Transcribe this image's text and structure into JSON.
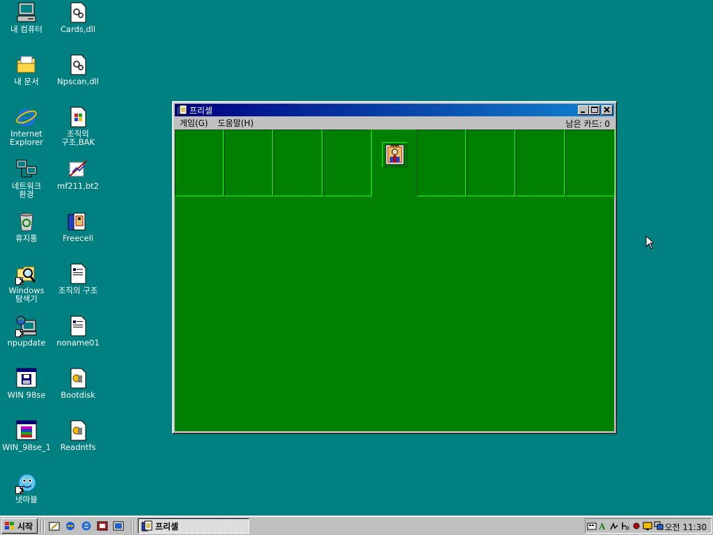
{
  "desktop": {
    "icons": [
      {
        "label": "내 컴퓨터",
        "icon": "my-computer"
      },
      {
        "label": "Cards,dll",
        "icon": "dll-file"
      },
      {
        "label": "내 문서",
        "icon": "my-documents"
      },
      {
        "label": "Npscan,dll",
        "icon": "dll-file"
      },
      {
        "label": "Internet\nExplorer",
        "icon": "internet-explorer"
      },
      {
        "label": "조직의\n구조,BAK",
        "icon": "bak-file"
      },
      {
        "label": "네트워크\n환경",
        "icon": "network"
      },
      {
        "label": "mf211,bt2",
        "icon": "bt2-file"
      },
      {
        "label": "휴지통",
        "icon": "recycle-bin"
      },
      {
        "label": "Freecell",
        "icon": "freecell"
      },
      {
        "label": "Windows\n탐색기",
        "icon": "explorer"
      },
      {
        "label": "조직의 구조",
        "icon": "document"
      },
      {
        "label": "npupdate",
        "icon": "npupdate"
      },
      {
        "label": "noname01",
        "icon": "document"
      },
      {
        "label": "WIN 98se",
        "icon": "floppy-window"
      },
      {
        "label": "Bootdisk",
        "icon": "batch-file"
      },
      {
        "label": "WIN_98se_1",
        "icon": "winrar"
      },
      {
        "label": "Readntfs",
        "icon": "batch-file"
      },
      {
        "label": "넷마블",
        "icon": "netmarble"
      }
    ]
  },
  "window": {
    "title": "프리셀",
    "menu": [
      "게임(G)",
      "도움말(H)"
    ],
    "cards_left_label": "남은 카드: 0"
  },
  "taskbar": {
    "start_label": "시작",
    "task_label": "프리셀",
    "clock": "오전 11:30"
  },
  "colors": {
    "desktop": "#008080",
    "felt": "#008000",
    "titlebar": "#000080"
  }
}
